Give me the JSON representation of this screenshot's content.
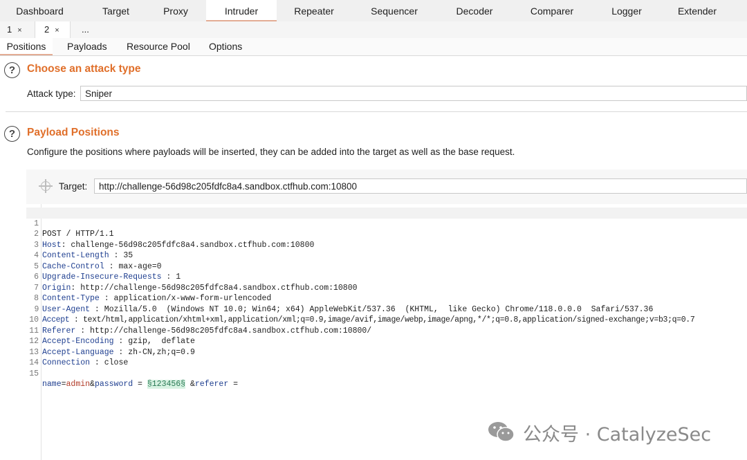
{
  "top_tabs": [
    "Dashboard",
    "Target",
    "Proxy",
    "Intruder",
    "Repeater",
    "Sequencer",
    "Decoder",
    "Comparer",
    "Logger",
    "Extender"
  ],
  "num_tabs": {
    "tab1": "1",
    "tab2": "2",
    "more": "...",
    "close": "×"
  },
  "section_tabs": [
    "Positions",
    "Payloads",
    "Resource Pool",
    "Options"
  ],
  "attack": {
    "title": "Choose an attack type",
    "type_label": "Attack type:",
    "type_value": "Sniper"
  },
  "positions": {
    "title": "Payload Positions",
    "description": "Configure the positions where payloads will be inserted, they can be added into the target as well as the base request.",
    "target_label": "Target:",
    "target_value": "http://challenge-56d98c205fdfc8a4.sandbox.ctfhub.com:10800"
  },
  "request": {
    "line_numbers": [
      "1",
      "2",
      "3",
      "4",
      "5",
      "6",
      "7",
      "8",
      "9",
      "10",
      "11",
      "12",
      "13",
      "14",
      "15"
    ],
    "request_line": "POST / HTTP/1.1",
    "headers": [
      {
        "name": "Host",
        "sep": ": ",
        "value": "challenge-56d98c205fdfc8a4.sandbox.ctfhub.com:10800"
      },
      {
        "name": "Content-Length",
        "sep": " : ",
        "value": "35"
      },
      {
        "name": "Cache-Control",
        "sep": " : ",
        "value": "max-age=0"
      },
      {
        "name": "Upgrade-Insecure-Requests",
        "sep": " : ",
        "value": "1"
      },
      {
        "name": "Origin",
        "sep": ": ",
        "value": "http://challenge-56d98c205fdfc8a4.sandbox.ctfhub.com:10800"
      },
      {
        "name": "Content-Type",
        "sep": " : ",
        "value": "application/x-www-form-urlencoded"
      },
      {
        "name": "User-Agent",
        "sep": " : ",
        "value": "Mozilla/5.0  (Windows NT 10.0; Win64; x64) AppleWebKit/537.36  (KHTML,  like Gecko) Chrome/118.0.0.0  Safari/537.36"
      },
      {
        "name": "Accept",
        "sep": " : ",
        "value": "text/html,application/xhtml+xml,application/xml;q=0.9,image/avif,image/webp,image/apng,*/*;q=0.8,application/signed-exchange;v=b3;q=0.7"
      },
      {
        "name": "Referer",
        "sep": " : ",
        "value": "http://challenge-56d98c205fdfc8a4.sandbox.ctfhub.com:10800/"
      },
      {
        "name": "Accept-Encoding",
        "sep": " : ",
        "value": "gzip,  deflate"
      },
      {
        "name": "Accept-Language",
        "sep": " : ",
        "value": "zh-CN,zh;q=0.9"
      },
      {
        "name": "Connection",
        "sep": " : ",
        "value": "close"
      }
    ],
    "body": {
      "name_key": "name",
      "eq1": "=",
      "name_val": "admin",
      "amp1": "&",
      "pass_key": "password",
      "eq2": " = ",
      "payload": "§123456§",
      "amp2": " &",
      "ref_key": "referer",
      "eq3": " ="
    }
  },
  "watermark": {
    "text": "公众号 · CatalyzeSec",
    "icon": "wechat-icon"
  },
  "colors": {
    "accent": "#e06f2a",
    "tab_underline": "#e3ac94",
    "payload_bg": "#d7f2e2"
  }
}
